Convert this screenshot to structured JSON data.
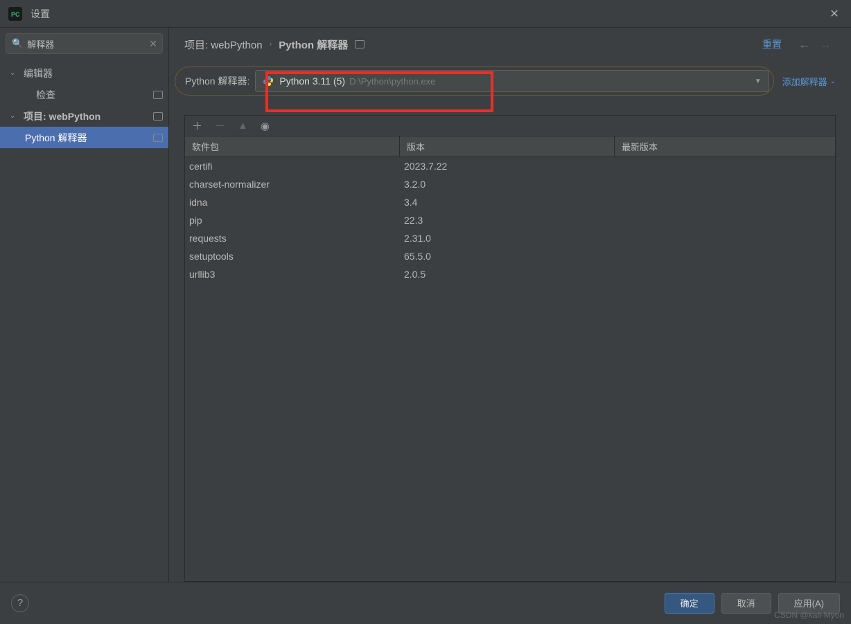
{
  "window": {
    "title": "设置"
  },
  "search": {
    "value": "解释器"
  },
  "sidebar": {
    "items": [
      {
        "label": "编辑器",
        "expanded": true,
        "bold": false
      },
      {
        "label": "检查",
        "child": true
      },
      {
        "label": "项目: webPython",
        "expanded": true,
        "bold": true
      },
      {
        "label": "Python 解释器",
        "grandchild": true,
        "selected": true
      }
    ]
  },
  "breadcrumb": {
    "project": "项目: webPython",
    "page": "Python 解释器",
    "reset": "重置"
  },
  "interpreter": {
    "label": "Python 解释器:",
    "name": "Python 3.11 (5)",
    "path": "D:\\Python\\python.exe",
    "add_link": "添加解释器"
  },
  "packages": {
    "columns": {
      "name": "软件包",
      "version": "版本",
      "latest": "最新版本"
    },
    "rows": [
      {
        "name": "certifi",
        "version": "2023.7.22",
        "latest": ""
      },
      {
        "name": "charset-normalizer",
        "version": "3.2.0",
        "latest": ""
      },
      {
        "name": "idna",
        "version": "3.4",
        "latest": ""
      },
      {
        "name": "pip",
        "version": "22.3",
        "latest": ""
      },
      {
        "name": "requests",
        "version": "2.31.0",
        "latest": ""
      },
      {
        "name": "setuptools",
        "version": "65.5.0",
        "latest": ""
      },
      {
        "name": "urllib3",
        "version": "2.0.5",
        "latest": ""
      }
    ]
  },
  "footer": {
    "ok": "确定",
    "cancel": "取消",
    "apply": "应用(A)"
  },
  "watermark": "CSDN @kali-Myon"
}
